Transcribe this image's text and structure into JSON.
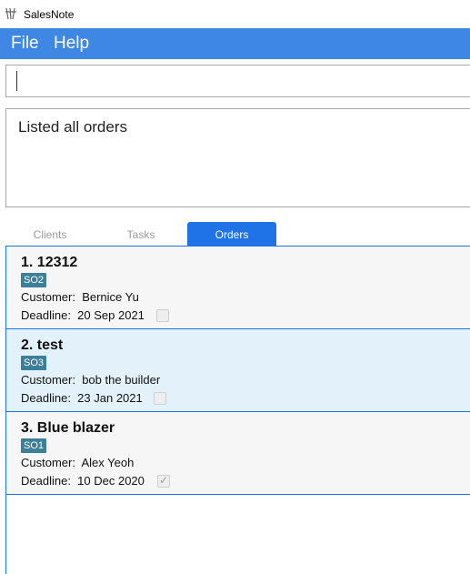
{
  "window": {
    "title": "SalesNote"
  },
  "menu": {
    "file": "File",
    "help": "Help"
  },
  "command": {
    "value": ""
  },
  "result": {
    "text": "Listed all orders"
  },
  "tabs": {
    "clients": "Clients",
    "tasks": "Tasks",
    "orders": "Orders",
    "active": "Orders"
  },
  "orders": [
    {
      "title": "1. 12312",
      "tag": "SO2",
      "customer_label": "Customer:",
      "customer": "Bernice Yu",
      "deadline_label": "Deadline:",
      "deadline": "20 Sep 2021",
      "done": false
    },
    {
      "title": "2. test",
      "tag": "SO3",
      "customer_label": "Customer:",
      "customer": "bob the builder",
      "deadline_label": "Deadline:",
      "deadline": "23 Jan 2021",
      "done": false
    },
    {
      "title": "3. Blue blazer",
      "tag": "SO1",
      "customer_label": "Customer:",
      "customer": "Alex Yeoh",
      "deadline_label": "Deadline:",
      "deadline": "10 Dec 2020",
      "done": true
    }
  ]
}
